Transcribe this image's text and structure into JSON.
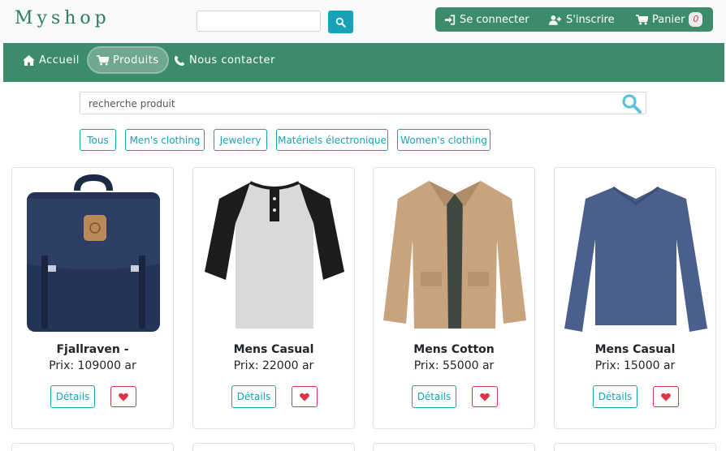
{
  "header": {
    "brand": "Myshop",
    "search_placeholder": "",
    "login_label": "Se connecter",
    "register_label": "S'inscrire",
    "cart_label": "Panier",
    "cart_count": "0"
  },
  "nav": {
    "items": [
      {
        "label": "Accueil",
        "icon": "home-icon"
      },
      {
        "label": "Produits",
        "icon": "cart-icon"
      },
      {
        "label": "Nous contacter",
        "icon": "phone-icon"
      }
    ],
    "active": "Produits"
  },
  "search": {
    "placeholder": "recherche produit"
  },
  "filters": [
    "Tous",
    "Men's clothing",
    "Jewelery",
    "Matériels électronique",
    "Women's clothing"
  ],
  "products": [
    {
      "title": "Fjallraven -",
      "price": "Prix: 109000 ar",
      "image": "backpack-image"
    },
    {
      "title": "Mens Casual",
      "price": "Prix: 22000 ar",
      "image": "raglan-tshirt-image"
    },
    {
      "title": "Mens Cotton",
      "price": "Prix: 55000 ar",
      "image": "cotton-jacket-image"
    },
    {
      "title": "Mens Casual",
      "price": "Prix: 15000 ar",
      "image": "blue-slim-tshirt-image"
    }
  ],
  "card_labels": {
    "details": "Détails"
  },
  "colors": {
    "primary_green": "#3c8c6b",
    "accent_teal": "#17a2b8",
    "favorite_red": "#dc3545"
  }
}
